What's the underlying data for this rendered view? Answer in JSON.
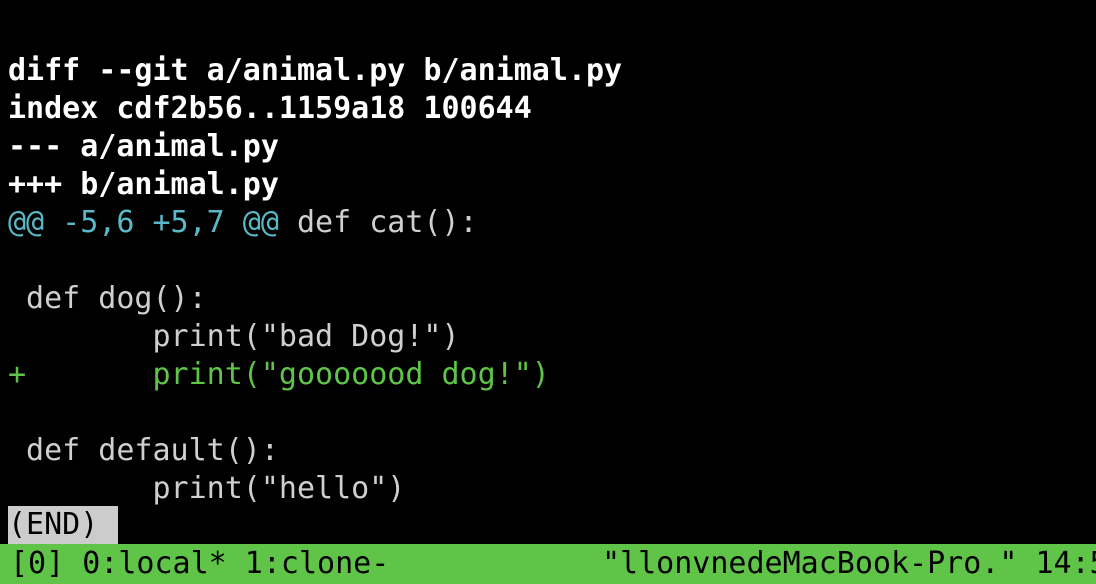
{
  "diff": {
    "header_lines": [
      "diff --git a/animal.py b/animal.py",
      "index cdf2b56..1159a18 100644",
      "--- a/animal.py",
      "+++ b/animal.py"
    ],
    "hunk_range": "@@ -5,6 +5,7 @@",
    "hunk_context": " def cat():",
    "body_lines": [
      "",
      " def dog():",
      "        print(\"bad Dog!\")",
      "+       print(\"gooooood dog!\")",
      "",
      " def default():",
      "        print(\"hello\")"
    ]
  },
  "pager": {
    "end_marker": "(END)"
  },
  "status_bar": {
    "left": "[0] 0:local* 1:clone-",
    "right": "\"llonvnedeMacBook-Pro.\" 14:5"
  },
  "colors": {
    "background": "#000000",
    "header": "#ffffff",
    "hunk": "#5ab9c6",
    "added": "#5fc447",
    "status_bar": "#5fc447"
  }
}
